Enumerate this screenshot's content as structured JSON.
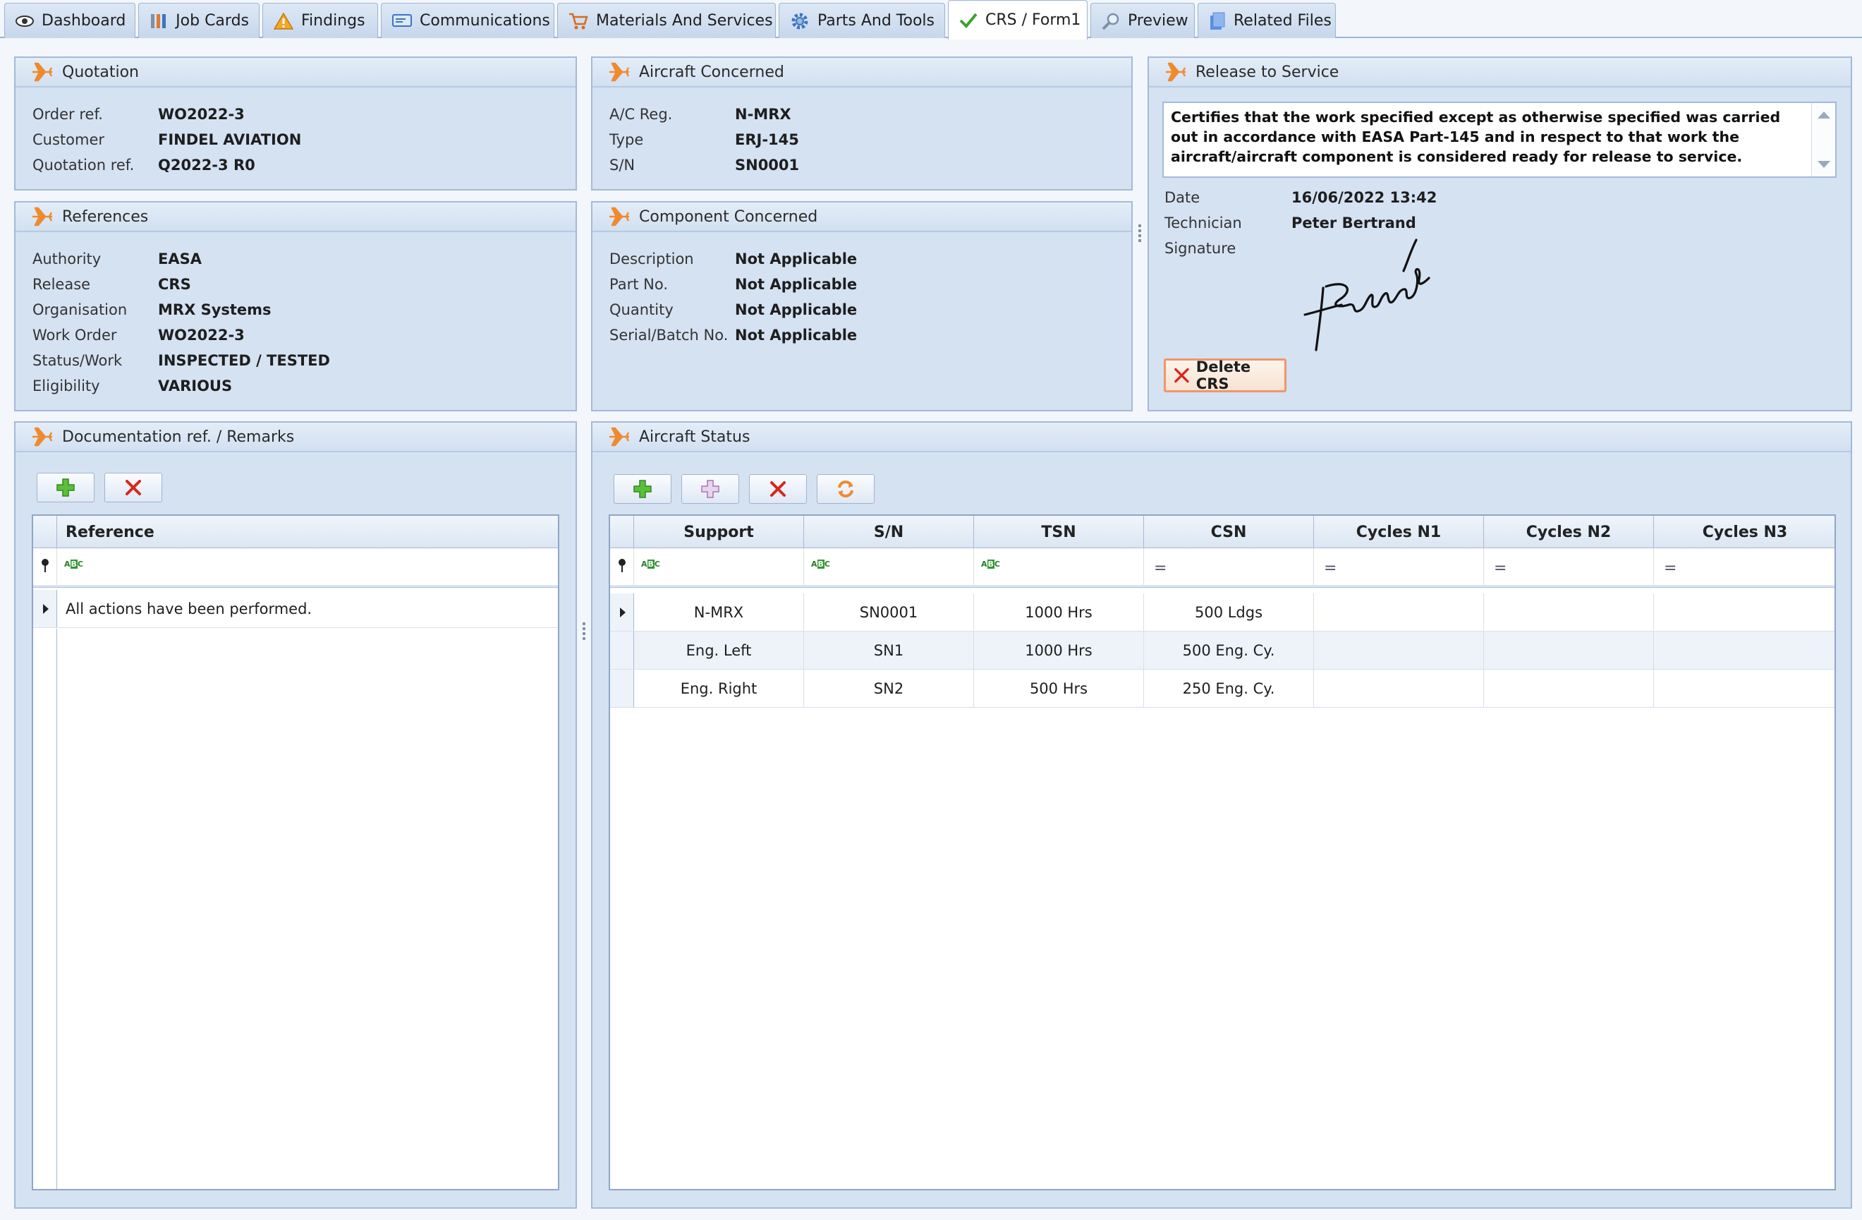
{
  "tabs": [
    {
      "label": "Dashboard",
      "icon": "eye-icon"
    },
    {
      "label": "Job Cards",
      "icon": "job-cards-icon"
    },
    {
      "label": "Findings",
      "icon": "warning-icon"
    },
    {
      "label": "Communications",
      "icon": "communications-icon"
    },
    {
      "label": "Materials And Services",
      "icon": "cart-icon"
    },
    {
      "label": "Parts And Tools",
      "icon": "gear-icon"
    },
    {
      "label": "CRS / Form1",
      "icon": "check-icon",
      "active": true
    },
    {
      "label": "Preview",
      "icon": "magnifier-icon"
    },
    {
      "label": "Related Files",
      "icon": "files-icon"
    }
  ],
  "quotation": {
    "title": "Quotation",
    "fields": [
      {
        "label": "Order ref.",
        "value": "WO2022-3"
      },
      {
        "label": "Customer",
        "value": "FINDEL AVIATION"
      },
      {
        "label": "Quotation ref.",
        "value": "Q2022-3 R0"
      }
    ]
  },
  "aircraft": {
    "title": "Aircraft Concerned",
    "fields": [
      {
        "label": "A/C Reg.",
        "value": "N-MRX"
      },
      {
        "label": "Type",
        "value": "ERJ-145"
      },
      {
        "label": "S/N",
        "value": "SN0001"
      }
    ]
  },
  "references": {
    "title": "References",
    "fields": [
      {
        "label": "Authority",
        "value": "EASA"
      },
      {
        "label": "Release",
        "value": "CRS"
      },
      {
        "label": "Organisation",
        "value": "MRX Systems"
      },
      {
        "label": "Work Order",
        "value": "WO2022-3"
      },
      {
        "label": "Status/Work",
        "value": "INSPECTED / TESTED"
      },
      {
        "label": "Eligibility",
        "value": "VARIOUS"
      }
    ]
  },
  "component": {
    "title": "Component Concerned",
    "fields": [
      {
        "label": "Description",
        "value": "Not Applicable"
      },
      {
        "label": "Part No.",
        "value": "Not Applicable"
      },
      {
        "label": "Quantity",
        "value": "Not Applicable"
      },
      {
        "label": "Serial/Batch No.",
        "value": "Not Applicable"
      }
    ]
  },
  "release": {
    "title": "Release to Service",
    "statement": "Certifies that the work specified except as otherwise specified was carried out in accordance with EASA Part-145 and in respect to that work the aircraft/aircraft component is considered ready for release to service.",
    "fields": [
      {
        "label": "Date",
        "value": "16/06/2022 13:42"
      },
      {
        "label": "Technician",
        "value": "Peter Bertrand"
      },
      {
        "label": "Signature",
        "value": ""
      }
    ],
    "signature_text": "Bertrand",
    "delete_label": "Delete CRS"
  },
  "documentation": {
    "title": "Documentation ref. / Remarks",
    "column": "Reference",
    "rows": [
      "All actions have been performed."
    ]
  },
  "aircraft_status": {
    "title": "Aircraft Status",
    "columns": [
      "Support",
      "S/N",
      "TSN",
      "CSN",
      "Cycles N1",
      "Cycles N2",
      "Cycles N3"
    ],
    "rows": [
      [
        "N-MRX",
        "SN0001",
        "1000 Hrs",
        "500 Ldgs",
        "",
        "",
        ""
      ],
      [
        "Eng. Left",
        "SN1",
        "1000 Hrs",
        "500 Eng. Cy.",
        "",
        "",
        ""
      ],
      [
        "Eng. Right",
        "SN2",
        "500 Hrs",
        "250 Eng. Cy.",
        "",
        "",
        ""
      ]
    ]
  },
  "colors": {
    "panel_bg": "#d5e2f2",
    "accent_orange": "#f08a2c",
    "delete_red": "#d9261c",
    "add_green": "#3fae2a"
  }
}
